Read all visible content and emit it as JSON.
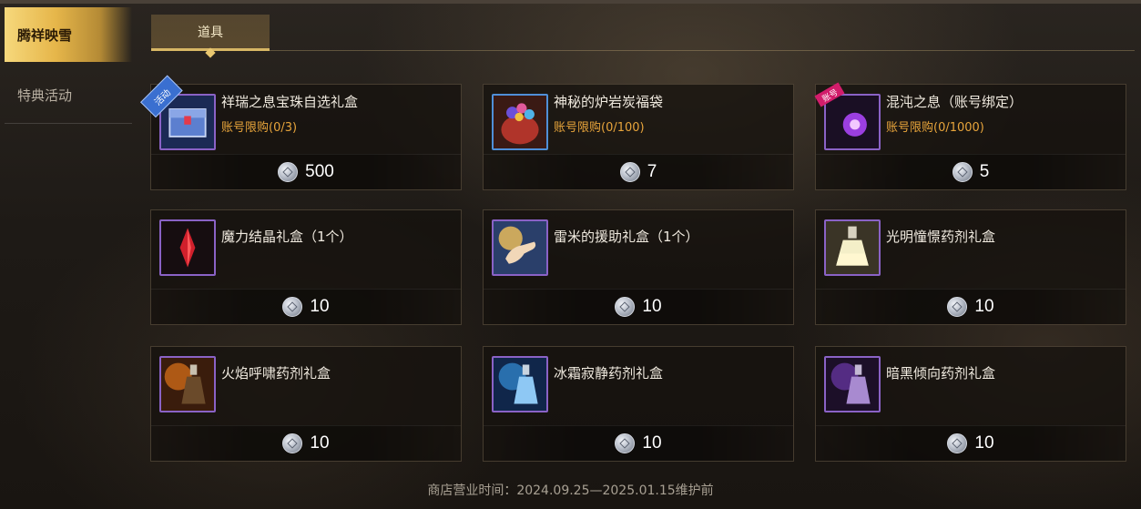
{
  "sidebar": {
    "items": [
      {
        "label": "腾祥映雪",
        "active": true
      },
      {
        "label": "特典活动",
        "active": false
      }
    ]
  },
  "tabs": [
    {
      "label": "道具",
      "active": true
    }
  ],
  "currency_icon": "silver-coin-icon",
  "items": [
    {
      "name": "祥瑞之息宝珠自选礼盒",
      "limit": "账号限购(0/3)",
      "price": "500",
      "icon": "blue-chest-icon",
      "badge": "活动"
    },
    {
      "name": "神秘的炉岩炭福袋",
      "limit": "账号限购(0/100)",
      "price": "7",
      "icon": "gem-bag-icon"
    },
    {
      "name": "混沌之息（账号绑定）",
      "limit": "账号限购(0/1000)",
      "price": "5",
      "icon": "purple-orb-icon",
      "badge": "账号"
    },
    {
      "name": "魔力结晶礼盒（1个）",
      "limit": "",
      "price": "10",
      "icon": "red-crystal-icon"
    },
    {
      "name": "雷米的援助礼盒（1个）",
      "limit": "",
      "price": "10",
      "icon": "helping-hand-icon"
    },
    {
      "name": "光明憧憬药剂礼盒",
      "limit": "",
      "price": "10",
      "icon": "light-potion-icon"
    },
    {
      "name": "火焰呼啸药剂礼盒",
      "limit": "",
      "price": "10",
      "icon": "fire-potion-icon"
    },
    {
      "name": "冰霜寂静药剂礼盒",
      "limit": "",
      "price": "10",
      "icon": "frost-potion-icon"
    },
    {
      "name": "暗黑倾向药剂礼盒",
      "limit": "",
      "price": "10",
      "icon": "dark-potion-icon"
    }
  ],
  "footer": {
    "text": "商店营业时间：2024.09.25—2025.01.15维护前"
  }
}
